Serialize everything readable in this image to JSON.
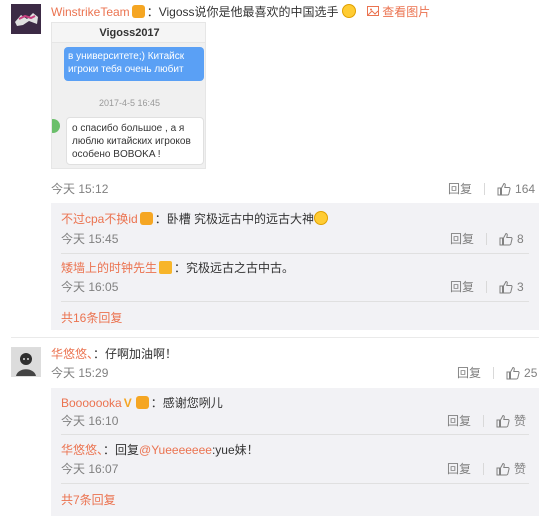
{
  "comment1": {
    "author": "WinstrikeTeam",
    "text": "：Vigoss说你是他最喜欢的中国选手",
    "view_image": "查看图片",
    "time": "今天 15:12",
    "reply": "回复",
    "likes": "164",
    "screenshot": {
      "contact": "Vigoss2017",
      "bubble_top": "в университете;) Китайск\nигроки тебя очень любит",
      "timestamp": "2017-4-5 16:45",
      "bubble_bottom": "о спасибо большое , а я\nлюблю китайских игроков\nособено BOBOKA !"
    },
    "replies": [
      {
        "author": "不过cpa不换id",
        "text": "：卧槽 究极远古中的远古大神",
        "time": "今天 15:45",
        "reply": "回复",
        "likes": "8"
      },
      {
        "author": "矮墙上的时钟先生",
        "text": "：究极远古之古中古。",
        "time": "今天 16:05",
        "reply": "回复",
        "likes": "3"
      }
    ],
    "more": "共16条回复"
  },
  "comment2": {
    "author": "华悠悠、",
    "text": "：仔啊加油啊！",
    "time": "今天 15:29",
    "reply": "回复",
    "likes": "25",
    "replies": [
      {
        "author": "Booooooka",
        "text": "：感谢您咧儿",
        "time": "今天 16:10",
        "reply": "回复",
        "likes": "赞"
      },
      {
        "author": "华悠悠、",
        "text_prefix": "：回复",
        "mention": "@Yueeeeeee",
        "text_suffix": ":yue妹！",
        "time": "今天 16:07",
        "reply": "回复",
        "likes": "赞"
      }
    ],
    "more": "共7条回复"
  }
}
